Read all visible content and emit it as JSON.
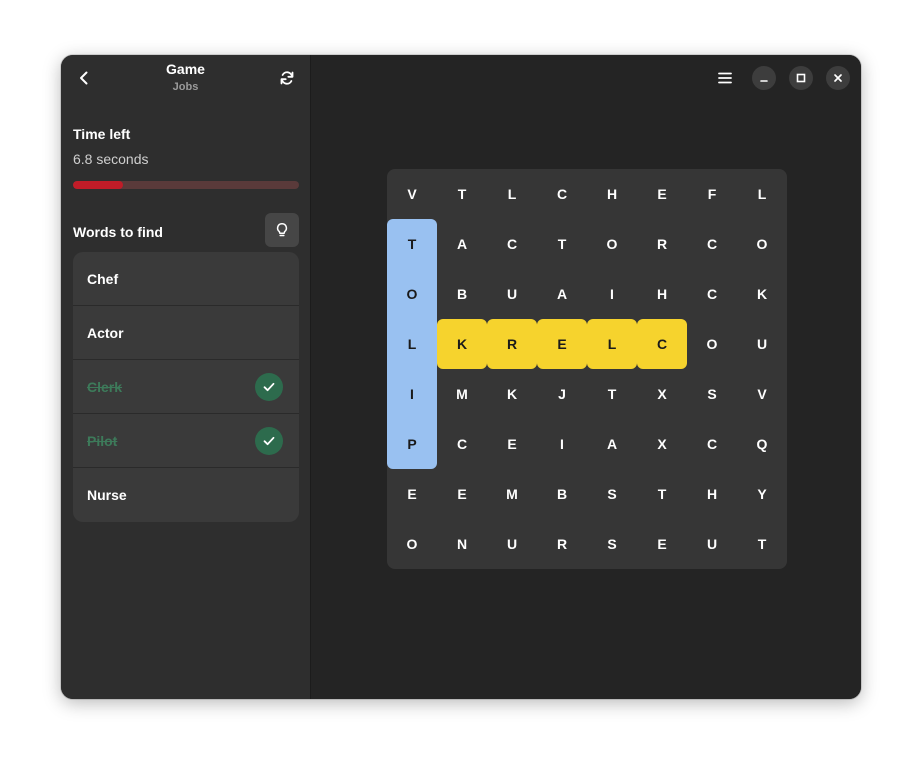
{
  "header": {
    "title": "Game",
    "subtitle": "Jobs",
    "back_icon": "chevron-left-icon",
    "refresh_icon": "refresh-icon"
  },
  "timer": {
    "label": "Time left",
    "value": "6.8 seconds",
    "progress_fraction": 0.22,
    "track_color": "#5a3a3a",
    "fill_color": "#c01c28"
  },
  "words": {
    "label": "Words to find",
    "hint_icon": "lightbulb-icon",
    "items": [
      {
        "text": "Chef",
        "found": false
      },
      {
        "text": "Actor",
        "found": false
      },
      {
        "text": "Clerk",
        "found": true
      },
      {
        "text": "Pilot",
        "found": true
      },
      {
        "text": "Nurse",
        "found": false
      }
    ]
  },
  "window_controls": {
    "menu_icon": "hamburger-menu-icon",
    "minimize_icon": "minimize-icon",
    "maximize_icon": "maximize-icon",
    "close_icon": "close-icon"
  },
  "grid": {
    "rows": [
      [
        "V",
        "T",
        "L",
        "C",
        "H",
        "E",
        "F",
        "L"
      ],
      [
        "T",
        "A",
        "C",
        "T",
        "O",
        "R",
        "C",
        "O"
      ],
      [
        "O",
        "B",
        "U",
        "A",
        "I",
        "H",
        "C",
        "K"
      ],
      [
        "L",
        "K",
        "R",
        "E",
        "L",
        "C",
        "O",
        "U"
      ],
      [
        "I",
        "M",
        "K",
        "J",
        "T",
        "X",
        "S",
        "V"
      ],
      [
        "P",
        "C",
        "E",
        "I",
        "A",
        "X",
        "C",
        "Q"
      ],
      [
        "E",
        "E",
        "M",
        "B",
        "S",
        "T",
        "H",
        "Y"
      ],
      [
        "O",
        "N",
        "U",
        "R",
        "S",
        "E",
        "U",
        "T"
      ]
    ],
    "highlights": {
      "blue": [
        [
          1,
          0
        ],
        [
          2,
          0
        ],
        [
          3,
          0
        ],
        [
          4,
          0
        ],
        [
          5,
          0
        ]
      ],
      "yellow": [
        [
          3,
          1
        ],
        [
          3,
          2
        ],
        [
          3,
          3
        ],
        [
          3,
          4
        ],
        [
          3,
          5
        ]
      ]
    },
    "colors": {
      "blue": "#99c1f1",
      "yellow": "#f6d32d"
    }
  }
}
